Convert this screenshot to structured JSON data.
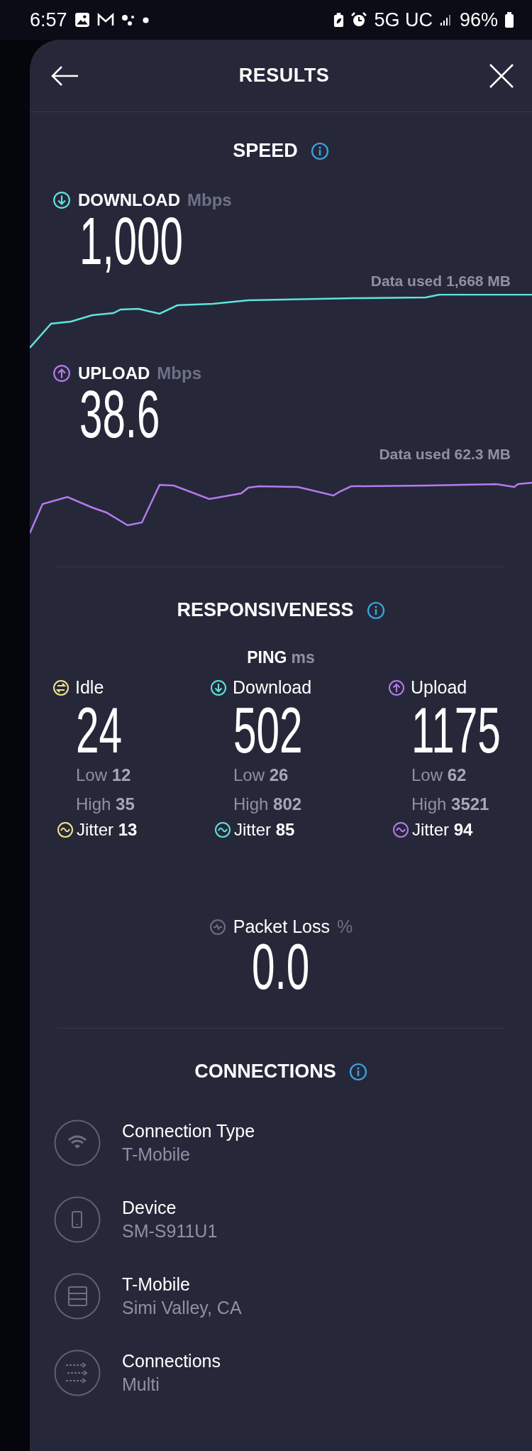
{
  "status_bar": {
    "time": "6:57",
    "network": "5G UC",
    "battery": "96%"
  },
  "header": {
    "title": "RESULTS"
  },
  "speed": {
    "title": "SPEED",
    "tests": [
      {
        "kind": "download",
        "label": "DOWNLOAD",
        "unit": "Mbps",
        "value": "1,000",
        "data_used": "Data used 1,668 MB",
        "color": "#5fe3dc"
      },
      {
        "kind": "upload",
        "label": "UPLOAD",
        "unit": "Mbps",
        "value": "38.6",
        "data_used": "Data used 62.3 MB",
        "color": "#b57af0"
      }
    ]
  },
  "responsiveness": {
    "title": "RESPONSIVENESS",
    "ping_label": "PING",
    "ping_unit": "ms",
    "columns": [
      {
        "kind": "idle",
        "label": "Idle",
        "value": "24",
        "low": "Low **12**",
        "high": "High **35**",
        "jitter": "Jitter **13**",
        "color": "#f2e58c"
      },
      {
        "kind": "download",
        "label": "Download",
        "value": "502",
        "low": "Low **26**",
        "high": "High **802**",
        "jitter": "Jitter **85**",
        "color": "#5fe3dc"
      },
      {
        "kind": "upload",
        "label": "Upload",
        "value": "1175",
        "low": "Low **62**",
        "high": "High **3521**",
        "jitter": "Jitter **94**",
        "color": "#b57af0"
      }
    ],
    "packet_loss": {
      "label": "Packet Loss",
      "unit": "%",
      "value": "0.0"
    }
  },
  "connections": {
    "title": "CONNECTIONS",
    "items": [
      {
        "kind": "wifi",
        "title": "Connection Type",
        "detail": "T-Mobile"
      },
      {
        "kind": "device",
        "title": "Device",
        "detail": "SM-S911U1"
      },
      {
        "kind": "server",
        "title": "T-Mobile",
        "detail": "Simi Valley, CA"
      },
      {
        "kind": "multi",
        "title": "Connections",
        "detail": "Multi"
      }
    ]
  }
}
